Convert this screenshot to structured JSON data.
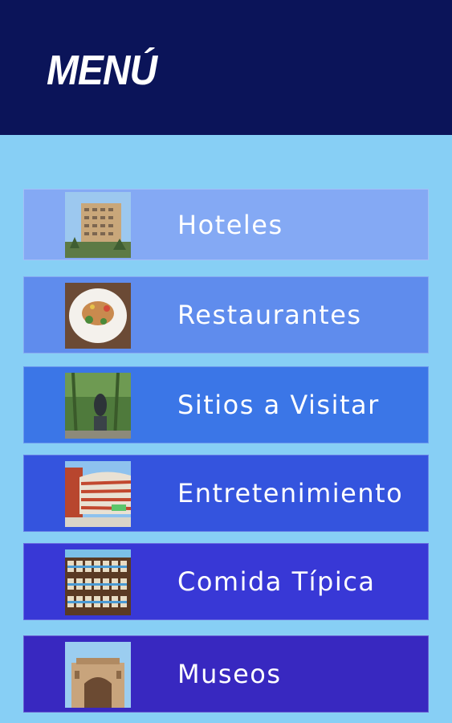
{
  "header": {
    "title": "MENÚ",
    "background": "#0b1459"
  },
  "page": {
    "background": "#87cff5"
  },
  "menu": {
    "items": [
      {
        "label": "Hoteles",
        "color": "#84a9f4",
        "image": "hotel-building-image"
      },
      {
        "label": "Restaurantes",
        "color": "#5f8ced",
        "image": "food-plate-image"
      },
      {
        "label": "Sitios a Visitar",
        "color": "#3b76e7",
        "image": "garden-statue-image"
      },
      {
        "label": "Entretenimiento",
        "color": "#3454de",
        "image": "modern-building-image"
      },
      {
        "label": "Comida Típica",
        "color": "#3838d6",
        "image": "market-shelves-image"
      },
      {
        "label": "Museos",
        "color": "#3828c0",
        "image": "museum-facade-image"
      }
    ]
  }
}
